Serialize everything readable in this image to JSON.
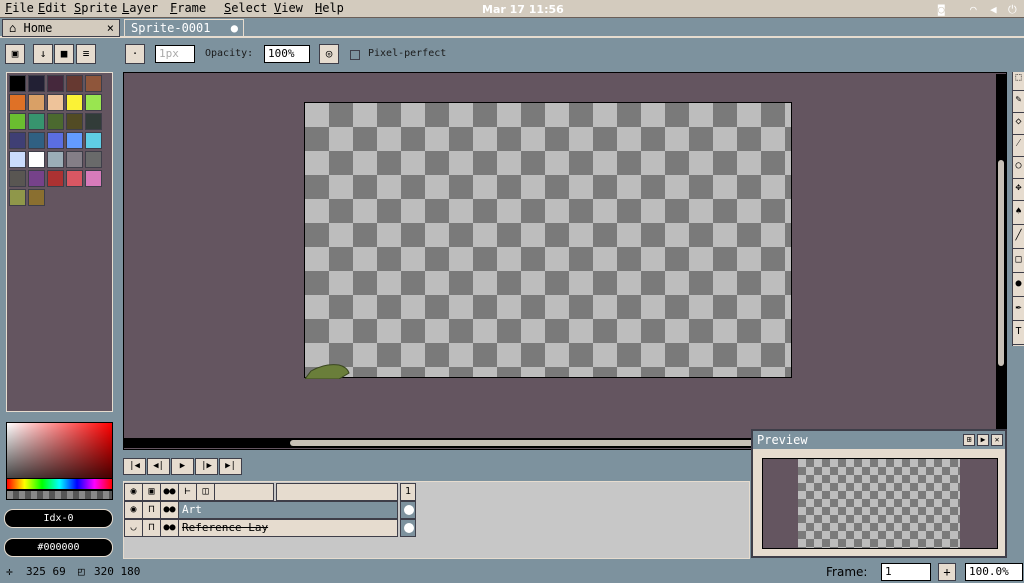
{
  "menubar": {
    "items": [
      "File",
      "Edit",
      "Sprite",
      "Layer",
      "Frame",
      "Select",
      "View",
      "Help"
    ],
    "clock": "Mar 17  11:56"
  },
  "tabs": [
    {
      "label": "Home",
      "close": "×"
    },
    {
      "label": "Sprite-0001",
      "close": "●"
    }
  ],
  "toolbar": {
    "brush_size": "1px",
    "opacity_label": "Opacity:",
    "opacity_value": "100%",
    "pixel_perfect_label": "Pixel-perfect"
  },
  "palette": {
    "colors": [
      "#000000",
      "#222034",
      "#45283c",
      "#663931",
      "#8f563b",
      "#df7126",
      "#d9a066",
      "#eec39a",
      "#fbf236",
      "#99e550",
      "#6abe30",
      "#37946e",
      "#4b692f",
      "#524b24",
      "#323c39",
      "#3f3f74",
      "#306082",
      "#5b6ee1",
      "#639bff",
      "#5fcde4",
      "#cbdbfc",
      "#ffffff",
      "#9badb7",
      "#847e87",
      "#696a6a",
      "#595652",
      "#76428a",
      "#ac3232",
      "#d95763",
      "#d77bba",
      "#8f974a",
      "#8a6f30"
    ]
  },
  "color_info": {
    "index": "Idx-0",
    "hex": "#000000"
  },
  "timeline": {
    "frame_number": "1",
    "layers": [
      {
        "name": "Art"
      },
      {
        "name": "Reference Lay"
      }
    ]
  },
  "preview": {
    "title": "Preview"
  },
  "statusbar": {
    "cursor": "325  69",
    "size": "320  180",
    "frame_label": "Frame:",
    "frame_value": "1",
    "zoom": "100.0%"
  }
}
